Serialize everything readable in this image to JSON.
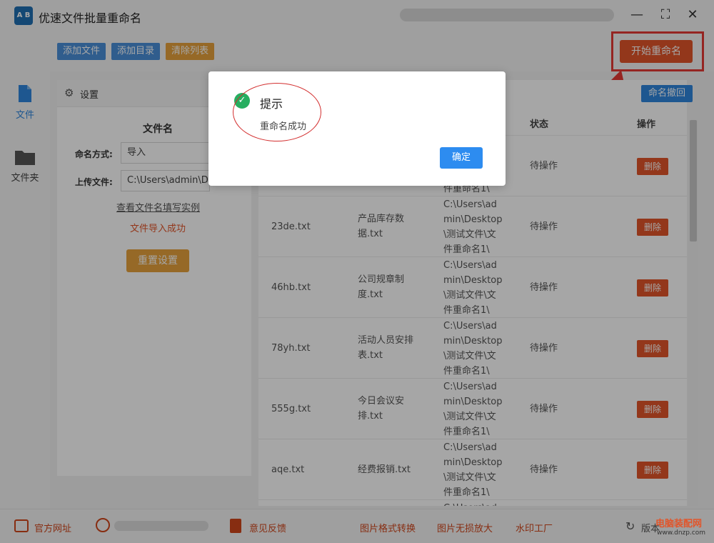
{
  "app": {
    "title": "优速文件批量重命名",
    "logo_text": "A B"
  },
  "toolbar": {
    "add_files": "添加文件",
    "add_folder": "添加目录",
    "clear_list": "清除列表",
    "start_rename": "开始重命名"
  },
  "sidebar": {
    "items": [
      {
        "label": "文件"
      },
      {
        "label": "文件夹"
      }
    ]
  },
  "settings": {
    "header": "设置",
    "section_title": "文件名",
    "naming_label": "命名方式:",
    "naming_value": "导入",
    "upload_label": "上传文件:",
    "upload_value": "C:\\Users\\admin\\De",
    "example_link": "查看文件名填写实例",
    "import_status": "文件导入成功",
    "reset_button": "重置设置"
  },
  "table": {
    "undo_button": "命名撤回",
    "headers": {
      "status": "状态",
      "action": "操作"
    },
    "first_row_path_tail": "件重命名1\\",
    "rows": [
      {
        "old": "23de.txt",
        "new_line1": "产品库存数",
        "new_line2": "据.txt",
        "path": [
          "C:\\Users\\ad",
          "min\\Desktop",
          "\\测试文件\\文",
          "件重命名1\\"
        ],
        "status": "待操作",
        "action": "删除"
      },
      {
        "old": "46hb.txt",
        "new_line1": "公司规章制",
        "new_line2": "度.txt",
        "path": [
          "C:\\Users\\ad",
          "min\\Desktop",
          "\\测试文件\\文",
          "件重命名1\\"
        ],
        "status": "待操作",
        "action": "删除"
      },
      {
        "old": "78yh.txt",
        "new_line1": "活动人员安排",
        "new_line2": "表.txt",
        "path": [
          "C:\\Users\\ad",
          "min\\Desktop",
          "\\测试文件\\文",
          "件重命名1\\"
        ],
        "status": "待操作",
        "action": "删除"
      },
      {
        "old": "555g.txt",
        "new_line1": "今日会议安",
        "new_line2": "排.txt",
        "path": [
          "C:\\Users\\ad",
          "min\\Desktop",
          "\\测试文件\\文",
          "件重命名1\\"
        ],
        "status": "待操作",
        "action": "删除"
      },
      {
        "old": "aqe.txt",
        "new_line1": "经费报销.txt",
        "new_line2": "",
        "path": [
          "C:\\Users\\ad",
          "min\\Desktop",
          "\\测试文件\\文",
          "件重命名1\\"
        ],
        "status": "待操作",
        "action": "删除"
      }
    ],
    "first_row": {
      "status": "待操作",
      "action": "删除"
    },
    "last_partial": "C:\\Users\\ad"
  },
  "dialog": {
    "title": "提示",
    "message": "重命名成功",
    "ok_button": "确定"
  },
  "footer": {
    "official_site": "官方网址",
    "feedback": "意见反馈",
    "img_convert": "图片格式转换",
    "img_enlarge": "图片无损放大",
    "watermark": "水印工厂",
    "version": "版本"
  },
  "watermark": {
    "line1": "电脑装配网",
    "line2": "www.dnzp.com"
  },
  "colors": {
    "accent_orange": "#e2552a",
    "blue": "#2e86de",
    "gold": "#e6a23c",
    "success": "#27ae60"
  }
}
